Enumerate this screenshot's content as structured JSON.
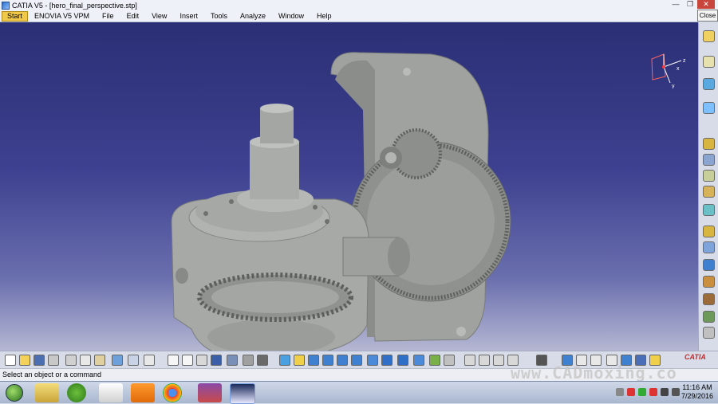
{
  "window": {
    "title": "CATIA V5 - [hero_final_perspective.stp]",
    "controls": {
      "minimize": "—",
      "restore": "❐",
      "close": "✕"
    },
    "close_label": "Close"
  },
  "menu": [
    "Start",
    "ENOVIA V5 VPM",
    "File",
    "Edit",
    "View",
    "Insert",
    "Tools",
    "Analyze",
    "Window",
    "Help"
  ],
  "status": {
    "message": "Select an object or a command"
  },
  "watermark": "www.CADmoxing.co",
  "brand": "CATIA",
  "taskbar": {
    "time": "11:16 AM",
    "date": "7/29/2016"
  },
  "colors": {
    "background_top": "#2b2f75",
    "background_bottom": "#b5b7d2",
    "model_gray": "#a3a6a3",
    "active_menu": "#f0c84a"
  },
  "icons": {
    "right_toolbar": [
      "select-arrow-icon",
      "snap-icon",
      "rotate-icon",
      "pan-icon",
      "part-icon",
      "constraint-icon",
      "assembly-icon",
      "explode-icon",
      "measure-icon",
      "product-icon",
      "catalog-icon",
      "grid-icon",
      "render-icon",
      "tools-icon",
      "settings-icon",
      "sphere-icon"
    ],
    "bottom_toolbar": [
      "new-icon",
      "open-icon",
      "save-icon",
      "print-icon",
      "cut-icon",
      "copy-icon",
      "paste-icon",
      "undo-icon",
      "redo-icon",
      "whats-this-icon",
      "formula-icon",
      "comment-icon",
      "macro-icon",
      "table-icon",
      "knowledge-icon",
      "fly-icon",
      "fit-all-icon",
      "pan-icon",
      "rotate-icon",
      "zoom-in-icon",
      "zoom-out-icon",
      "normal-view-icon",
      "iso-view-icon",
      "render-style-icon",
      "hide-show-icon",
      "swap-icon",
      "axis-icon",
      "measure-icon",
      "compass-icon",
      "search-icon",
      "tree-icon",
      "analysis-icon"
    ]
  }
}
